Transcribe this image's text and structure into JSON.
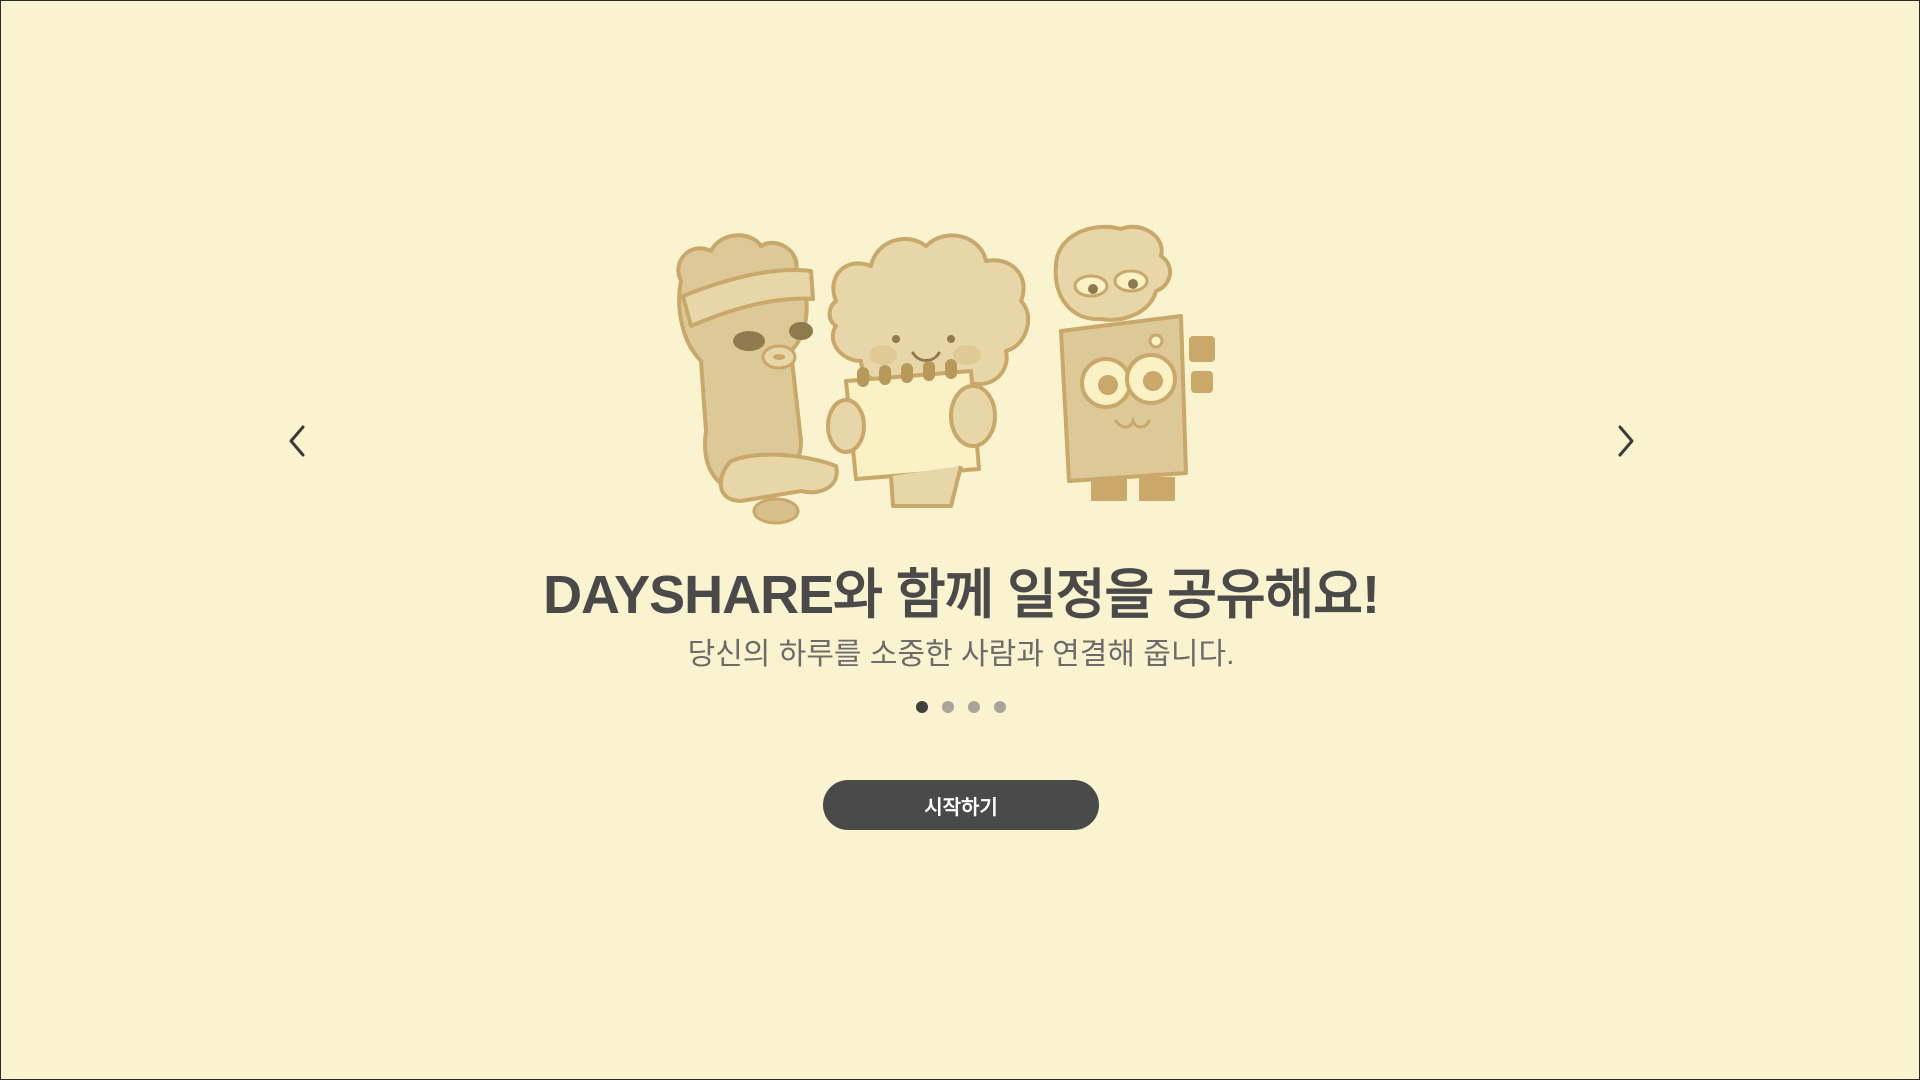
{
  "onboarding": {
    "headline": "DAYSHARE와 함께 일정을 공유해요!",
    "subline": "당신의 하루를 소중한 사람과 연결해 줍니다.",
    "start_label": "시작하기",
    "current_slide": 1,
    "total_slides": 4,
    "dots": [
      {
        "active": true
      },
      {
        "active": false
      },
      {
        "active": false
      },
      {
        "active": false
      }
    ]
  },
  "icons": {
    "prev": "chevron-left-icon",
    "next": "chevron-right-icon"
  },
  "colors": {
    "background": "#f9f3cf",
    "text_dark": "#4a4a4a",
    "text_muted": "#6b6b6b",
    "button_bg": "#4a4a4a",
    "button_text": "#ffffff",
    "dot_active": "#3f3f3f",
    "dot_inactive": "#a9a59a",
    "illustration_tone": "#c9a86a"
  }
}
